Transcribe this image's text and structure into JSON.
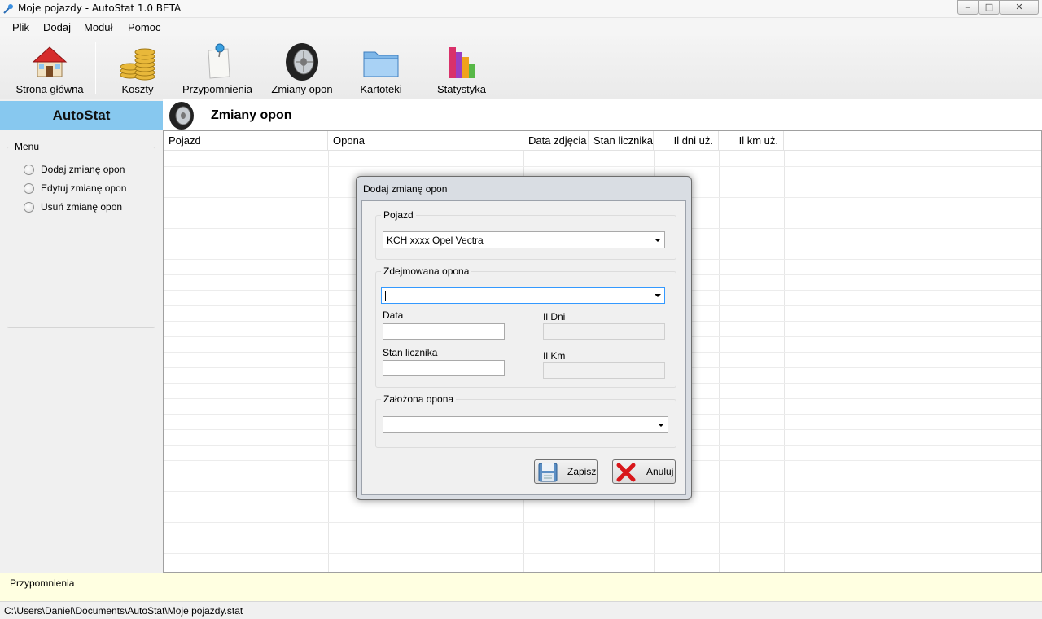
{
  "window": {
    "title": "Moje pojazdy - AutoStat 1.0 BETA",
    "controls": {
      "minimize": "–",
      "maximize": "□",
      "close": "✕"
    }
  },
  "menubar": [
    "Plik",
    "Dodaj",
    "Moduł",
    "Pomoc"
  ],
  "toolbar": {
    "buttons": [
      {
        "label": "Strona główna",
        "icon": "home-icon"
      },
      {
        "label": "Koszty",
        "icon": "coins-icon"
      },
      {
        "label": "Przypomnienia",
        "icon": "note-icon"
      },
      {
        "label": "Zmiany opon",
        "icon": "tire-icon"
      },
      {
        "label": "Kartoteki",
        "icon": "folder-icon"
      },
      {
        "label": "Statystyka",
        "icon": "bar-chart-icon"
      }
    ]
  },
  "sidebar": {
    "title": "AutoStat",
    "menu_label": "Menu",
    "items": [
      "Dodaj zmianę opon",
      "Edytuj zmianę opon",
      "Usuń zmianę opon"
    ]
  },
  "main": {
    "title": "Zmiany opon",
    "columns": [
      "Pojazd",
      "Opona",
      "Data zdjęcia",
      "Stan licznika",
      "Il dni uż.",
      "Il km uż."
    ]
  },
  "reminders": {
    "label": "Przypomnienia"
  },
  "statusbar": {
    "path": "C:\\Users\\Daniel\\Documents\\AutoStat\\Moje pojazdy.stat"
  },
  "dialog": {
    "title": "Dodaj zmianę opon",
    "vehicle_group": "Pojazd",
    "vehicle_value": "KCH xxxx Opel Vectra",
    "removed_group": "Zdejmowana opona",
    "removed_value": "",
    "date_label": "Data",
    "date_value": "",
    "days_label": "Il Dni",
    "odometer_label": "Stan licznika",
    "km_label": "Il Km",
    "installed_group": "Założona opona",
    "installed_value": "",
    "save_label": "Zapisz",
    "cancel_label": "Anuluj"
  },
  "colors": {
    "sidebar_header": "#87c8ef",
    "reminders_bg": "#ffffe1"
  }
}
